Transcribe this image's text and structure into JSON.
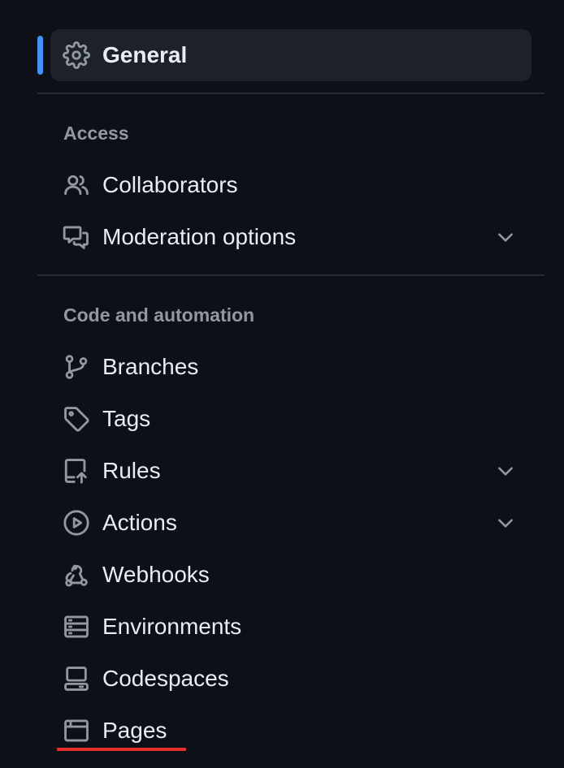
{
  "nav": {
    "general": {
      "label": "General",
      "icon": "gear-icon",
      "active": true
    },
    "sections": [
      {
        "heading": "Access",
        "items": [
          {
            "label": "Collaborators",
            "icon": "people-icon",
            "expandable": false
          },
          {
            "label": "Moderation options",
            "icon": "comment-discussion-icon",
            "expandable": true
          }
        ]
      },
      {
        "heading": "Code and automation",
        "items": [
          {
            "label": "Branches",
            "icon": "git-branch-icon",
            "expandable": false
          },
          {
            "label": "Tags",
            "icon": "tag-icon",
            "expandable": false
          },
          {
            "label": "Rules",
            "icon": "repo-push-icon",
            "expandable": true
          },
          {
            "label": "Actions",
            "icon": "play-icon",
            "expandable": true
          },
          {
            "label": "Webhooks",
            "icon": "webhook-icon",
            "expandable": false
          },
          {
            "label": "Environments",
            "icon": "server-icon",
            "expandable": false
          },
          {
            "label": "Codespaces",
            "icon": "codespaces-icon",
            "expandable": false
          },
          {
            "label": "Pages",
            "icon": "browser-icon",
            "expandable": false,
            "highlighted": true
          }
        ]
      }
    ]
  },
  "colors": {
    "background": "#0d1117",
    "active_indicator": "#4493f8",
    "selected_bg": "#1d2229",
    "text": "#e6edf3",
    "muted": "#9198a1",
    "highlight_underline": "#e5302a"
  }
}
